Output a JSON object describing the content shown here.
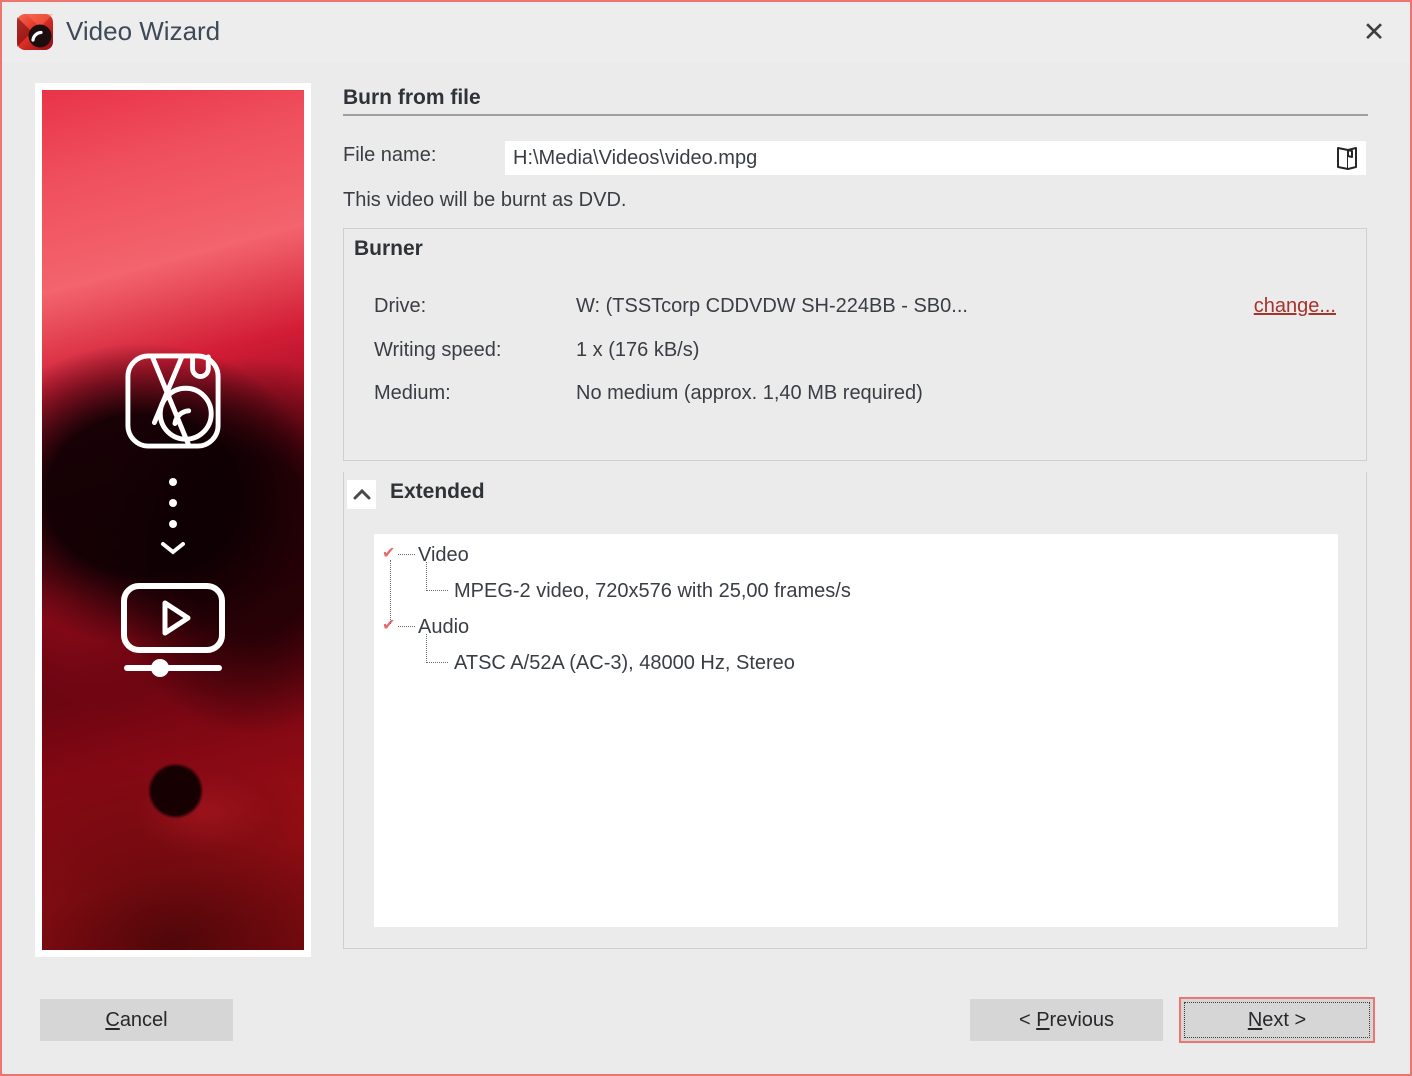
{
  "window": {
    "title": "Video Wizard",
    "close_glyph": "✕"
  },
  "wizard": {
    "heading": "Burn from file",
    "file_name_label": "File name:",
    "file_name_value": "H:\\Media\\Videos\\video.mpg",
    "note": "This video will be burnt as DVD."
  },
  "burner": {
    "title": "Burner",
    "drive_label": "Drive:",
    "drive_value": "W: (TSSTcorp CDDVDW SH-224BB - SB0...",
    "change_link": "change...",
    "speed_label": "Writing speed:",
    "speed_value": "1 x (176 kB/s)",
    "medium_label": "Medium:",
    "medium_value": "No medium (approx. 1,40 MB required)"
  },
  "extended": {
    "title": "Extended",
    "tree": [
      {
        "label": "Video",
        "detail": "MPEG-2 video, 720x576 with 25,00 frames/s"
      },
      {
        "label": "Audio",
        "detail": "ATSC A/52A (AC-3), 48000 Hz, Stereo"
      }
    ],
    "marker_glyph": "✔"
  },
  "buttons": {
    "cancel": {
      "pre": "",
      "key": "C",
      "post": "ancel"
    },
    "previous": {
      "pre": "< ",
      "key": "P",
      "post": "revious"
    },
    "next": {
      "pre": "",
      "key": "N",
      "post": "ext >"
    }
  },
  "icons": {
    "app": "burning-studio-logo",
    "close": "close-icon",
    "browse": "open-folder-icon",
    "collapse": "chevron-up-icon",
    "tree_marker": "expanded-node-arrow",
    "artwork": [
      "photo-logo-icon",
      "dots-down-arrow-icon",
      "video-player-icon"
    ]
  },
  "colors": {
    "window_border": "#ee7470",
    "background": "#ebebeb",
    "link_red": "#a8322c",
    "tree_marker_red": "#e96a6a",
    "button_face": "#d6d6d6",
    "focus_border": "#ee7470"
  }
}
